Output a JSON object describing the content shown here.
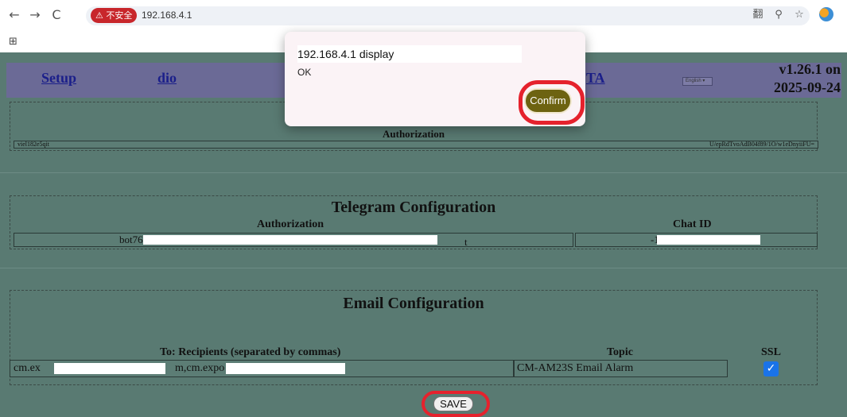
{
  "browser": {
    "back_icon": "←",
    "forward_icon": "→",
    "reload_icon": "C",
    "security_badge": "⚠ 不安全",
    "url": "192.168.4.1",
    "translate_icon": "翻",
    "zoom_icon": "⚲",
    "star_icon": "☆",
    "apps_icon": "⊞"
  },
  "nav": {
    "setup": "Setup",
    "dio": "dio",
    "ota": "TA",
    "language": "English",
    "version_line1": "v1.26.1 on",
    "version_line2": "2025-09-24"
  },
  "auth_section": {
    "title": "Authorization",
    "left_value": "viel182e5qit",
    "right_value": "U/epRdTvoAdB04f89/1O/w1eDnyiiFU="
  },
  "telegram": {
    "title": "Telegram Configuration",
    "auth_label": "Authorization",
    "chat_label": "Chat ID",
    "token_value": "bot762",
    "token_tail": "t",
    "chat_value": "-10"
  },
  "email": {
    "title": "Email Configuration",
    "recipients_label": "To: Recipients (separated by commas)",
    "topic_label": "Topic",
    "ssl_label": "SSL",
    "recipients_part1": "cm.ex",
    "recipients_part2": "m,cm.expo",
    "topic_value": "CM-AM23S Email Alarm",
    "ssl_checked": true,
    "check_glyph": "✓"
  },
  "save_label": "SAVE",
  "dialog": {
    "title": "192.168.4.1 display",
    "message": "OK",
    "confirm_label": "Confirm"
  }
}
